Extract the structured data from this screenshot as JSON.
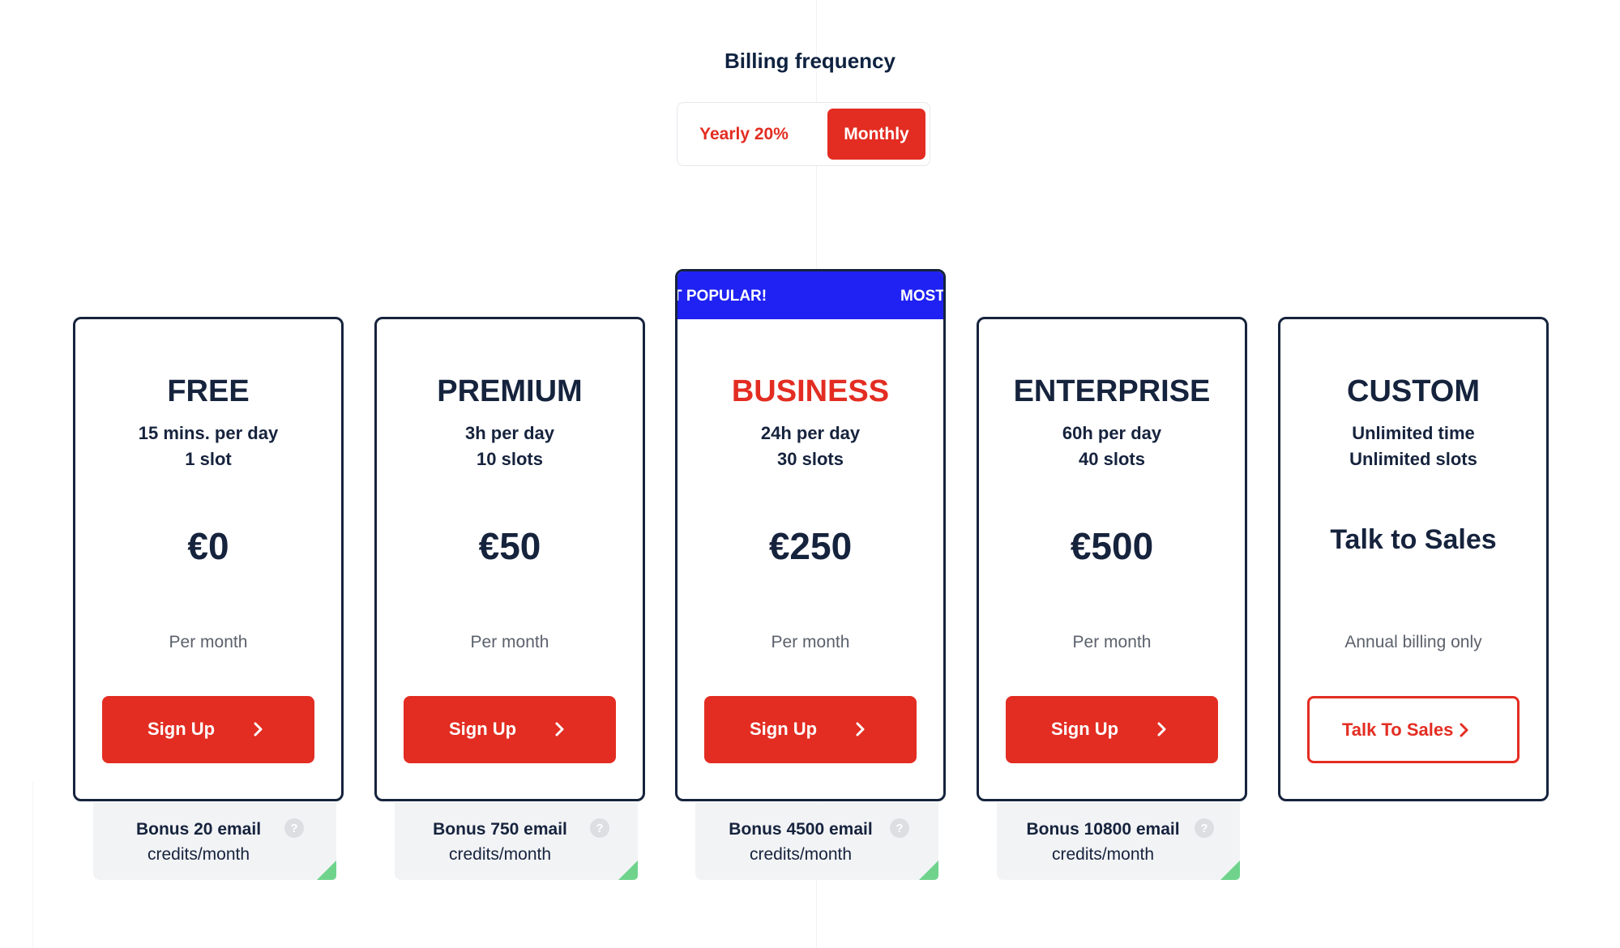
{
  "billing": {
    "title": "Billing frequency",
    "options": [
      "Yearly 20%",
      "Monthly"
    ],
    "selected": "Monthly"
  },
  "colors": {
    "accent": "#e32d22",
    "navy": "#16233d",
    "popular_banner": "#1f22f2",
    "bonus_bg": "#f2f3f5",
    "corner_green": "#6fd38c"
  },
  "popular_banner": [
    "T POPULAR!",
    "MOST"
  ],
  "plans": [
    {
      "name": "FREE",
      "line1": "15 mins. per day",
      "line2": "1 slot",
      "price": "€0",
      "period": "Per month",
      "button": "Sign Up",
      "bonus_line1": "Bonus 20 email",
      "bonus_line2": "credits/month"
    },
    {
      "name": "PREMIUM",
      "line1": "3h per day",
      "line2": "10 slots",
      "price": "€50",
      "period": "Per month",
      "button": "Sign Up",
      "bonus_line1": "Bonus 750 email",
      "bonus_line2": "credits/month"
    },
    {
      "name": "BUSINESS",
      "line1": "24h per day",
      "line2": "30 slots",
      "price": "€250",
      "period": "Per month",
      "button": "Sign Up",
      "bonus_line1": "Bonus 4500 email",
      "bonus_line2": "credits/month"
    },
    {
      "name": "ENTERPRISE",
      "line1": "60h per day",
      "line2": "40 slots",
      "price": "€500",
      "period": "Per month",
      "button": "Sign Up",
      "bonus_line1": "Bonus 10800 email",
      "bonus_line2": "credits/month"
    },
    {
      "name": "CUSTOM",
      "line1": "Unlimited time",
      "line2": "Unlimited slots",
      "price": "Talk to Sales",
      "period": "Annual billing only",
      "button": "Talk To Sales"
    }
  ],
  "icons": {
    "button_arrow": "chevron-right-icon",
    "bonus_help": "question-mark-icon",
    "bonus_corner": "green-corner-icon"
  },
  "help_glyph": "?"
}
